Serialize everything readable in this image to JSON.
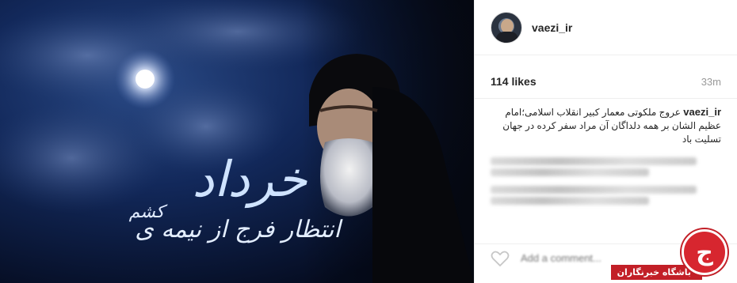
{
  "post": {
    "username": "vaezi_ir",
    "likes": "114 likes",
    "time_ago": "33m",
    "caption": {
      "user": "vaezi_ir",
      "text": "عروج ملکوتی معمار کبیر انقلاب اسلامی؛امام عظیم الشان بر همه دلداگان آن مراد سفر کرده در جهان تسلیت باد"
    },
    "add_comment_placeholder": "Add a comment..."
  },
  "image": {
    "calligraphy_main": "خرداد",
    "calligraphy_line": "انتظار فرج از نیمه ی",
    "calligraphy_end": "کشم"
  },
  "watermark": {
    "label": "باشگاه خبرنگاران",
    "logo": "ج"
  },
  "colors": {
    "accent_red": "#d7262f",
    "sky_dark": "#0b1a3a",
    "calligraphy_blue": "#cfe3ff"
  }
}
